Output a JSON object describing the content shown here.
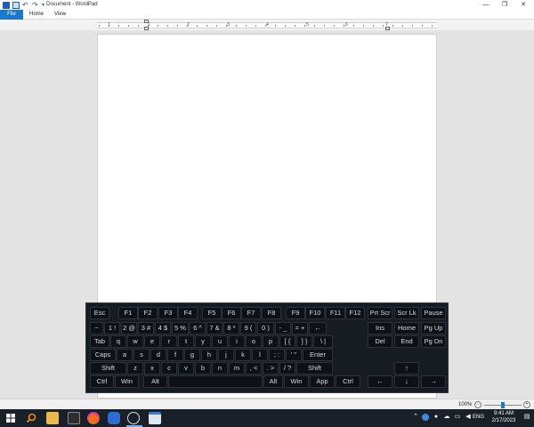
{
  "window": {
    "title": "Document - WordPad",
    "minimize": "—",
    "maximize": "❐",
    "close": "✕"
  },
  "ribbon": {
    "tabs": [
      {
        "label": "File"
      },
      {
        "label": "Home"
      },
      {
        "label": "View"
      }
    ]
  },
  "ruler": {
    "numbers": [
      "1",
      "1",
      "2",
      "3",
      "4",
      "5",
      "6",
      "7"
    ]
  },
  "statusbar": {
    "zoom_percent": "100%",
    "zoom_minus": "−",
    "zoom_plus": "+",
    "zoom_level": 1.0
  },
  "keyboard": {
    "rows": {
      "fn": [
        "Esc",
        "F1",
        "F2",
        "F3",
        "F4",
        "F5",
        "F6",
        "F7",
        "F8",
        "F9",
        "F10",
        "F11",
        "F12",
        "Prt Scr",
        "Scr Lk",
        "Pause"
      ],
      "num": [
        "~",
        "1 !",
        "2 @",
        "3 #",
        "4 $",
        "5 %",
        "6 ^",
        "7 &",
        "8 *",
        "9 (",
        "0 )",
        "- _",
        "= +",
        "←",
        "Ins",
        "Home",
        "Pg Up"
      ],
      "tab": [
        "Tab",
        "q",
        "w",
        "e",
        "r",
        "t",
        "y",
        "u",
        "i",
        "o",
        "p",
        "[ {",
        "] }",
        "\\ |",
        "Del",
        "End",
        "Pg Dn"
      ],
      "caps": [
        "Caps",
        "a",
        "s",
        "d",
        "f",
        "g",
        "h",
        "j",
        "k",
        "l",
        "; :",
        "' \"",
        "Enter"
      ],
      "shift": [
        "Shift",
        "z",
        "x",
        "c",
        "v",
        "b",
        "n",
        "m",
        ", <",
        ". >",
        "/ ?",
        "Shift",
        "↑"
      ],
      "bottom": [
        "Ctrl",
        "Win",
        "Alt",
        "",
        "Alt",
        "Win",
        "App",
        "Ctrl",
        "←",
        "↓",
        "→"
      ]
    }
  },
  "taskbar": {
    "language": "ENG",
    "time": "9:41 AM",
    "date": "2/17/2023"
  },
  "colors": {
    "accent": "#1979ca",
    "keyboard_bg": "#161c22",
    "taskbar_bg": "#1a2027"
  }
}
